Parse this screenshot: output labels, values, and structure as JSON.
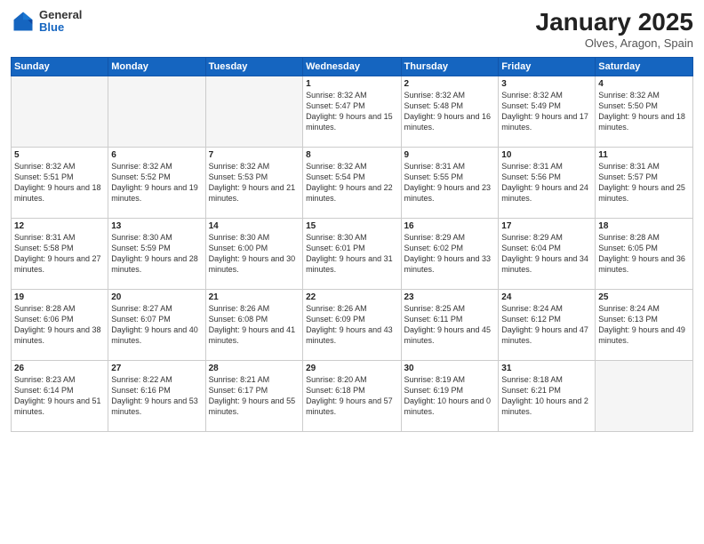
{
  "logo": {
    "general": "General",
    "blue": "Blue"
  },
  "header": {
    "month": "January 2025",
    "location": "Olves, Aragon, Spain"
  },
  "weekdays": [
    "Sunday",
    "Monday",
    "Tuesday",
    "Wednesday",
    "Thursday",
    "Friday",
    "Saturday"
  ],
  "weeks": [
    [
      {
        "day": "",
        "empty": true
      },
      {
        "day": "",
        "empty": true
      },
      {
        "day": "",
        "empty": true
      },
      {
        "day": "1",
        "sunrise": "8:32 AM",
        "sunset": "5:47 PM",
        "daylight": "9 hours and 15 minutes."
      },
      {
        "day": "2",
        "sunrise": "8:32 AM",
        "sunset": "5:48 PM",
        "daylight": "9 hours and 16 minutes."
      },
      {
        "day": "3",
        "sunrise": "8:32 AM",
        "sunset": "5:49 PM",
        "daylight": "9 hours and 17 minutes."
      },
      {
        "day": "4",
        "sunrise": "8:32 AM",
        "sunset": "5:50 PM",
        "daylight": "9 hours and 18 minutes."
      }
    ],
    [
      {
        "day": "5",
        "sunrise": "8:32 AM",
        "sunset": "5:51 PM",
        "daylight": "9 hours and 18 minutes."
      },
      {
        "day": "6",
        "sunrise": "8:32 AM",
        "sunset": "5:52 PM",
        "daylight": "9 hours and 19 minutes."
      },
      {
        "day": "7",
        "sunrise": "8:32 AM",
        "sunset": "5:53 PM",
        "daylight": "9 hours and 21 minutes."
      },
      {
        "day": "8",
        "sunrise": "8:32 AM",
        "sunset": "5:54 PM",
        "daylight": "9 hours and 22 minutes."
      },
      {
        "day": "9",
        "sunrise": "8:31 AM",
        "sunset": "5:55 PM",
        "daylight": "9 hours and 23 minutes."
      },
      {
        "day": "10",
        "sunrise": "8:31 AM",
        "sunset": "5:56 PM",
        "daylight": "9 hours and 24 minutes."
      },
      {
        "day": "11",
        "sunrise": "8:31 AM",
        "sunset": "5:57 PM",
        "daylight": "9 hours and 25 minutes."
      }
    ],
    [
      {
        "day": "12",
        "sunrise": "8:31 AM",
        "sunset": "5:58 PM",
        "daylight": "9 hours and 27 minutes."
      },
      {
        "day": "13",
        "sunrise": "8:30 AM",
        "sunset": "5:59 PM",
        "daylight": "9 hours and 28 minutes."
      },
      {
        "day": "14",
        "sunrise": "8:30 AM",
        "sunset": "6:00 PM",
        "daylight": "9 hours and 30 minutes."
      },
      {
        "day": "15",
        "sunrise": "8:30 AM",
        "sunset": "6:01 PM",
        "daylight": "9 hours and 31 minutes."
      },
      {
        "day": "16",
        "sunrise": "8:29 AM",
        "sunset": "6:02 PM",
        "daylight": "9 hours and 33 minutes."
      },
      {
        "day": "17",
        "sunrise": "8:29 AM",
        "sunset": "6:04 PM",
        "daylight": "9 hours and 34 minutes."
      },
      {
        "day": "18",
        "sunrise": "8:28 AM",
        "sunset": "6:05 PM",
        "daylight": "9 hours and 36 minutes."
      }
    ],
    [
      {
        "day": "19",
        "sunrise": "8:28 AM",
        "sunset": "6:06 PM",
        "daylight": "9 hours and 38 minutes."
      },
      {
        "day": "20",
        "sunrise": "8:27 AM",
        "sunset": "6:07 PM",
        "daylight": "9 hours and 40 minutes."
      },
      {
        "day": "21",
        "sunrise": "8:26 AM",
        "sunset": "6:08 PM",
        "daylight": "9 hours and 41 minutes."
      },
      {
        "day": "22",
        "sunrise": "8:26 AM",
        "sunset": "6:09 PM",
        "daylight": "9 hours and 43 minutes."
      },
      {
        "day": "23",
        "sunrise": "8:25 AM",
        "sunset": "6:11 PM",
        "daylight": "9 hours and 45 minutes."
      },
      {
        "day": "24",
        "sunrise": "8:24 AM",
        "sunset": "6:12 PM",
        "daylight": "9 hours and 47 minutes."
      },
      {
        "day": "25",
        "sunrise": "8:24 AM",
        "sunset": "6:13 PM",
        "daylight": "9 hours and 49 minutes."
      }
    ],
    [
      {
        "day": "26",
        "sunrise": "8:23 AM",
        "sunset": "6:14 PM",
        "daylight": "9 hours and 51 minutes."
      },
      {
        "day": "27",
        "sunrise": "8:22 AM",
        "sunset": "6:16 PM",
        "daylight": "9 hours and 53 minutes."
      },
      {
        "day": "28",
        "sunrise": "8:21 AM",
        "sunset": "6:17 PM",
        "daylight": "9 hours and 55 minutes."
      },
      {
        "day": "29",
        "sunrise": "8:20 AM",
        "sunset": "6:18 PM",
        "daylight": "9 hours and 57 minutes."
      },
      {
        "day": "30",
        "sunrise": "8:19 AM",
        "sunset": "6:19 PM",
        "daylight": "10 hours and 0 minutes."
      },
      {
        "day": "31",
        "sunrise": "8:18 AM",
        "sunset": "6:21 PM",
        "daylight": "10 hours and 2 minutes."
      },
      {
        "day": "",
        "empty": true
      }
    ]
  ]
}
